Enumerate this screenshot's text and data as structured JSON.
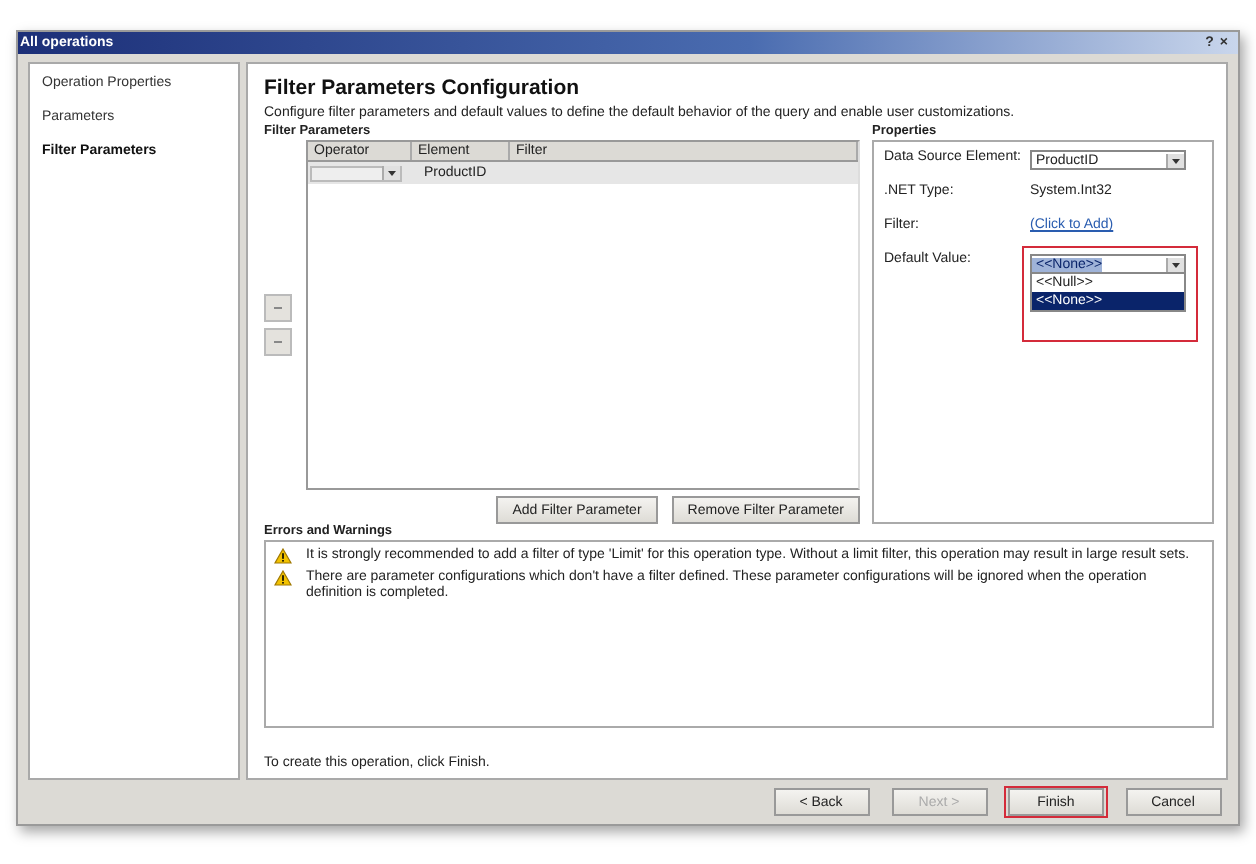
{
  "window": {
    "title": "All operations",
    "help_glyph": "?",
    "close_glyph": "×"
  },
  "sidebar": {
    "items": [
      {
        "label": "Operation Properties",
        "selected": false
      },
      {
        "label": "Parameters",
        "selected": false
      },
      {
        "label": "Filter Parameters",
        "selected": true
      }
    ]
  },
  "heading": "Filter Parameters Configuration",
  "description": "Configure filter parameters and default values to define the default behavior of the query and enable user customizations.",
  "filter_parameters": {
    "label": "Filter Parameters",
    "columns": [
      "Operator",
      "Element",
      "Filter"
    ],
    "rows": [
      {
        "operator": "",
        "element": "ProductID",
        "filter": "",
        "selected": true
      }
    ],
    "buttons": [
      "Add Filter Parameter",
      "Remove Filter Parameter"
    ]
  },
  "properties": {
    "label": "Properties",
    "fields": [
      {
        "label": "Data Source Element:",
        "kind": "dropdown",
        "value": "ProductID"
      },
      {
        "label": ".NET Type:",
        "kind": "text",
        "value": "System.Int32"
      },
      {
        "label": "Filter:",
        "kind": "link",
        "value": "(Click to Add)"
      },
      {
        "label": "Default Value:",
        "kind": "dropdown",
        "value": "<<None>>",
        "expanded": true,
        "highlighted": true,
        "options": [
          {
            "label": "<<Null>>",
            "selected": false
          },
          {
            "label": "<<None>>",
            "selected": true
          }
        ]
      }
    ]
  },
  "errors": {
    "label": "Errors and Warnings",
    "messages": [
      "It is strongly recommended to add a filter of type 'Limit' for this operation type. Without a limit filter, this operation may result in large result sets.",
      "There are parameter configurations which don't have a filter defined. These parameter configurations will be ignored when the operation definition is completed."
    ]
  },
  "footer_note": "To create this operation, click Finish.",
  "buttons": [
    {
      "label": "< Back",
      "disabled": false,
      "highlighted": false
    },
    {
      "label": "Next >",
      "disabled": true,
      "highlighted": false
    },
    {
      "label": "Finish",
      "disabled": false,
      "highlighted": true
    },
    {
      "label": "Cancel",
      "disabled": false,
      "highlighted": false
    }
  ]
}
